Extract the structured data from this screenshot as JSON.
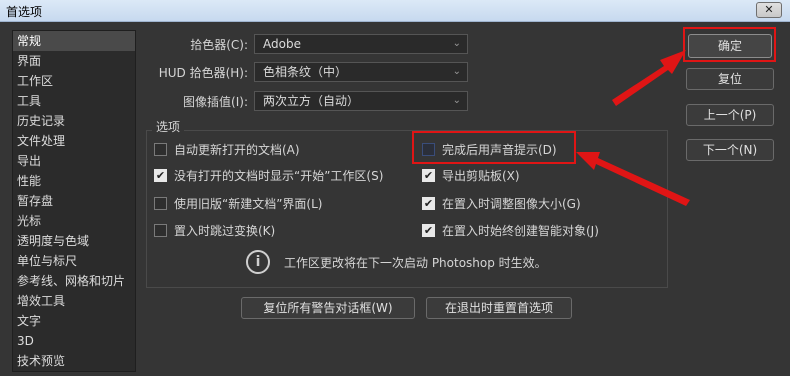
{
  "window": {
    "title": "首选项",
    "close_label": "✕"
  },
  "sidebar": {
    "items": [
      {
        "label": "常规",
        "active": true
      },
      {
        "label": "界面"
      },
      {
        "label": "工作区"
      },
      {
        "label": "工具"
      },
      {
        "label": "历史记录"
      },
      {
        "label": "文件处理"
      },
      {
        "label": "导出"
      },
      {
        "label": "性能"
      },
      {
        "label": "暂存盘"
      },
      {
        "label": "光标"
      },
      {
        "label": "透明度与色域"
      },
      {
        "label": "单位与标尺"
      },
      {
        "label": "参考线、网格和切片"
      },
      {
        "label": "增效工具"
      },
      {
        "label": "文字"
      },
      {
        "label": "3D"
      },
      {
        "label": "技术预览"
      }
    ]
  },
  "settings": {
    "color_picker": {
      "label": "拾色器(C):",
      "value": "Adobe"
    },
    "hud_color_picker": {
      "label": "HUD 拾色器(H):",
      "value": "色相条纹（中）"
    },
    "image_interpolation": {
      "label": "图像插值(I):",
      "value": "两次立方（自动）"
    }
  },
  "options": {
    "title": "选项",
    "left": [
      {
        "label": "自动更新打开的文档(A)",
        "checked": false
      },
      {
        "label": "没有打开的文档时显示“开始”工作区(S)",
        "checked": true
      },
      {
        "label": "使用旧版“新建文档”界面(L)",
        "checked": false
      },
      {
        "label": "置入时跳过变换(K)",
        "checked": false
      }
    ],
    "right": [
      {
        "label": "完成后用声音提示(D)",
        "checked": false
      },
      {
        "label": "导出剪贴板(X)",
        "checked": true
      },
      {
        "label": "在置入时调整图像大小(G)",
        "checked": true
      },
      {
        "label": "在置入时始终创建智能对象(J)",
        "checked": true
      }
    ],
    "info": "工作区更改将在下一次启动 Photoshop 时生效。"
  },
  "bottom_buttons": {
    "reset_warnings": "复位所有警告对话框(W)",
    "reset_on_exit": "在退出时重置首选项"
  },
  "side_buttons": {
    "ok": "确定",
    "reset": "复位",
    "prev": "上一个(P)",
    "next": "下一个(N)"
  },
  "icons": {
    "check": "✔",
    "chevron": "⌄",
    "info": "i"
  },
  "colors": {
    "highlight_red": "#e01515"
  }
}
